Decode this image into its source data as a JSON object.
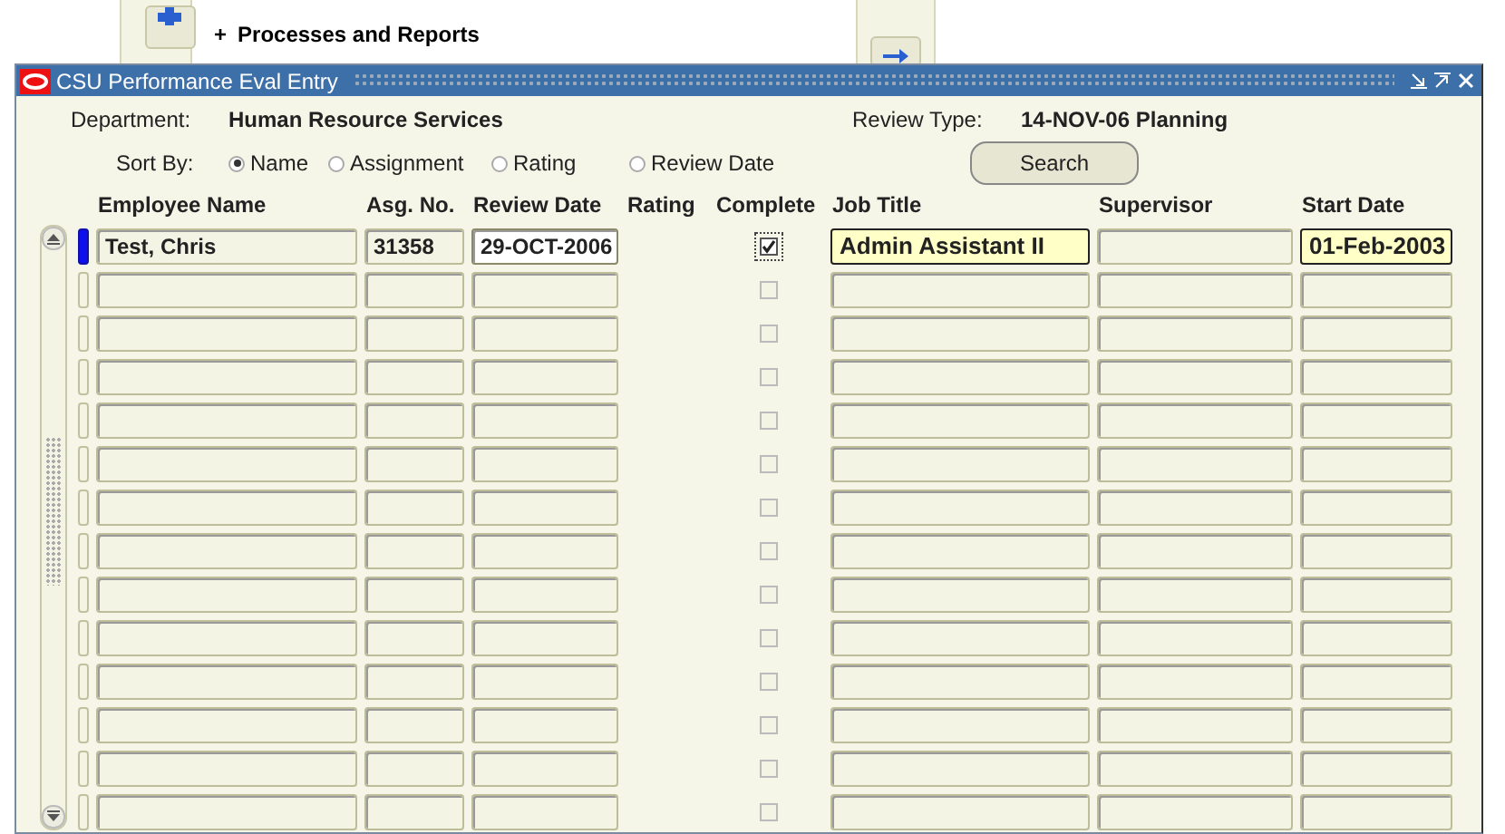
{
  "background": {
    "menu_item": {
      "bullet": "+",
      "label": "Processes and Reports"
    }
  },
  "window": {
    "title": "CSU Performance Eval Entry",
    "department": {
      "label": "Department:",
      "value": "Human Resource Services"
    },
    "review_type": {
      "label": "Review Type:",
      "value": "14-NOV-06 Planning"
    },
    "sort_by": {
      "label": "Sort By:",
      "options": [
        {
          "label": "Name",
          "selected": true
        },
        {
          "label": "Assignment",
          "selected": false
        },
        {
          "label": "Rating",
          "selected": false
        },
        {
          "label": "Review Date",
          "selected": false
        }
      ]
    },
    "search_button": "Search",
    "columns": [
      "Employee Name",
      "Asg. No.",
      "Review Date",
      "Rating",
      "Complete",
      "Job Title",
      "Supervisor",
      "Start Date"
    ],
    "rows": [
      {
        "selected": true,
        "complete": true,
        "fields": [
          {
            "value": "Test, Chris",
            "kind": "plain"
          },
          {
            "value": "31358",
            "kind": "plain"
          },
          {
            "value": "29-OCT-2006",
            "kind": "focused"
          },
          {
            "value": "Admin Assistant II",
            "kind": "highlighted"
          },
          {
            "kind": "plain"
          },
          {
            "value": "01-Feb-2003",
            "kind": "highlighted"
          }
        ]
      },
      {
        "selected": false,
        "complete": false
      },
      {
        "selected": false,
        "complete": false
      },
      {
        "selected": false,
        "complete": false
      },
      {
        "selected": false,
        "complete": false
      },
      {
        "selected": false,
        "complete": false
      },
      {
        "selected": false,
        "complete": false
      },
      {
        "selected": false,
        "complete": false
      },
      {
        "selected": false,
        "complete": false
      },
      {
        "selected": false,
        "complete": false
      },
      {
        "selected": false,
        "complete": false
      },
      {
        "selected": false,
        "complete": false
      },
      {
        "selected": false,
        "complete": false
      },
      {
        "selected": false,
        "complete": false
      }
    ]
  }
}
